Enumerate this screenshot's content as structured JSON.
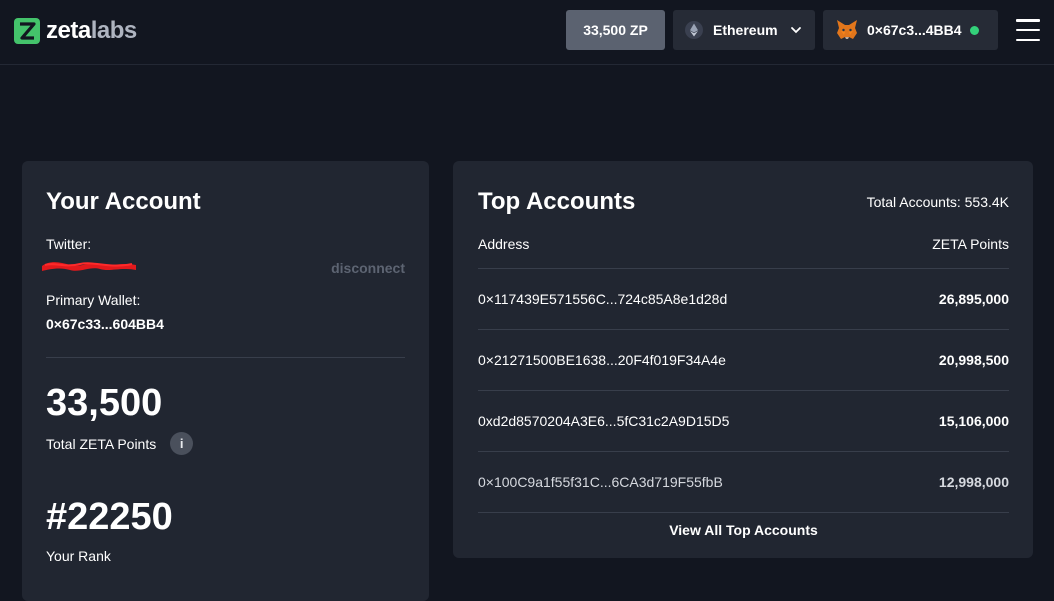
{
  "header": {
    "logo_word1": "zeta",
    "logo_word2": "labs",
    "points_pill": "33,500 ZP",
    "chain_label": "Ethereum",
    "wallet_label": "0×67c3...4BB4",
    "colors": {
      "accent_green": "#44c36b",
      "connected_dot": "#33d17a"
    }
  },
  "account": {
    "title": "Your Account",
    "twitter_label": "Twitter:",
    "disconnect_label": "disconnect",
    "primary_wallet_label": "Primary Wallet:",
    "primary_wallet_value": "0×67c33...604BB4",
    "points_value": "33,500",
    "points_label": "Total ZETA Points",
    "info_glyph": "i",
    "rank_value": "#22250",
    "rank_label": "Your Rank"
  },
  "top_accounts": {
    "title": "Top Accounts",
    "total_label": "Total Accounts: 553.4K",
    "columns": {
      "address": "Address",
      "points": "ZETA Points"
    },
    "rows": [
      {
        "address": "0×117439E571556C...724c85A8e1d28d",
        "points": "26,895,000"
      },
      {
        "address": "0×21271500BE1638...20F4f019F34A4e",
        "points": "20,998,500"
      },
      {
        "address": "0xd2d8570204A3E6...5fC31c2A9D15D5",
        "points": "15,106,000"
      },
      {
        "address": "0×100C9a1f55f31C...6CA3d719F55fbB",
        "points": "12,998,000"
      }
    ],
    "view_all_label": "View All Top Accounts"
  },
  "icons": [
    "zeta-logo-icon",
    "ethereum-icon",
    "chevron-down-icon",
    "metamask-fox-icon",
    "hamburger-menu-icon",
    "info-icon"
  ]
}
